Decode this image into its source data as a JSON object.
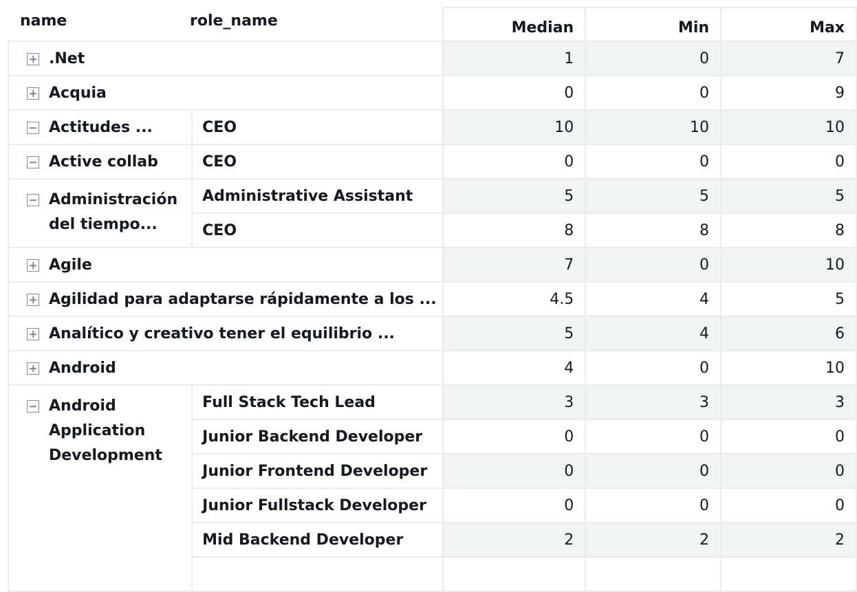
{
  "row_headers": {
    "name": "name",
    "role": "role_name"
  },
  "measures": {
    "median": "Median",
    "min": "Min",
    "max": "Max"
  },
  "groups": [
    {
      "name": ".Net",
      "expanded": false,
      "role": "",
      "median": "1",
      "min": "0",
      "max": "7"
    },
    {
      "name": "Acquia",
      "expanded": false,
      "role": "",
      "median": "0",
      "min": "0",
      "max": "9"
    },
    {
      "name": "Actitudes ...",
      "expanded": true,
      "roles": [
        {
          "role": "CEO",
          "median": "10",
          "min": "10",
          "max": "10"
        }
      ]
    },
    {
      "name": "Active collab",
      "expanded": true,
      "roles": [
        {
          "role": "CEO",
          "median": "0",
          "min": "0",
          "max": "0"
        }
      ]
    },
    {
      "name": "Administración del tiempo...",
      "expanded": true,
      "roles": [
        {
          "role": "Administrative Assistant",
          "median": "5",
          "min": "5",
          "max": "5"
        },
        {
          "role": "CEO",
          "median": "8",
          "min": "8",
          "max": "8"
        }
      ]
    },
    {
      "name": "Agile",
      "expanded": false,
      "role": "",
      "median": "7",
      "min": "0",
      "max": "10"
    },
    {
      "name": "Agilidad para adaptarse rápidamente a los ...",
      "expanded": false,
      "role": "",
      "median": "4.5",
      "min": "4",
      "max": "5"
    },
    {
      "name": "Analítico y creativo tener el equilibrio ...",
      "expanded": false,
      "role": "",
      "median": "5",
      "min": "4",
      "max": "6"
    },
    {
      "name": "Android",
      "expanded": false,
      "role": "",
      "median": "4",
      "min": "0",
      "max": "10"
    },
    {
      "name": "Android Application Development",
      "expanded": true,
      "roles": [
        {
          "role": "Full Stack Tech Lead",
          "median": "3",
          "min": "3",
          "max": "3"
        },
        {
          "role": "Junior Backend Developer",
          "median": "0",
          "min": "0",
          "max": "0"
        },
        {
          "role": "Junior Frontend Developer",
          "median": "0",
          "min": "0",
          "max": "0"
        },
        {
          "role": "Junior Fullstack Developer",
          "median": "0",
          "min": "0",
          "max": "0"
        },
        {
          "role": "Mid Backend Developer",
          "median": "2",
          "min": "2",
          "max": "2"
        },
        {
          "role": "",
          "median": "",
          "min": "",
          "max": ""
        }
      ]
    }
  ],
  "icons": {
    "expand": "plus-box-icon",
    "collapse": "minus-box-icon"
  },
  "colors": {
    "border": "#e9ebed",
    "shade": "#f2f3f3",
    "icon": "#7d8998",
    "text": "#16191f"
  }
}
